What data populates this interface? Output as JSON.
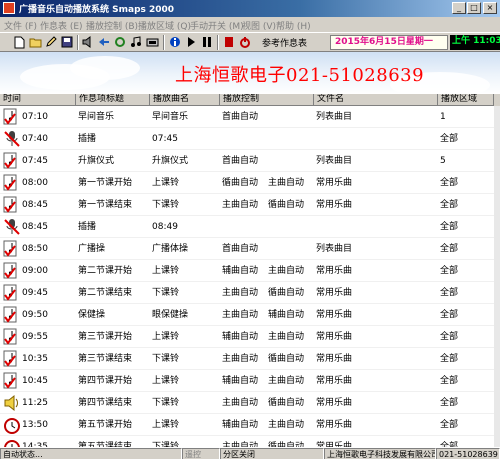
{
  "window": {
    "title": "广播音乐自动播放系统 Smaps 2000",
    "minimize": "_",
    "maximize": "□",
    "close": "×"
  },
  "menu": [
    "文件 (F)",
    "作息表 (E)",
    "播放控制 (B)",
    "播放区域 (Q)",
    "手动开关 (M)",
    "视图 (V)",
    "帮助 (H)"
  ],
  "toolbar": {
    "icons": [
      "new-file-icon",
      "open-folder-icon",
      "edit-icon",
      "save-icon",
      "speaker-icon",
      "back-icon",
      "refresh-icon",
      "music-icon",
      "panel-icon",
      "info-icon",
      "play-icon",
      "pause-icon",
      "bookmark-icon",
      "power-icon"
    ],
    "info_label": "参考作息表",
    "date": "2015年6月15日星期一",
    "clock": "上午 11:03"
  },
  "banner": {
    "company": "上海恒歌电子021-51028639"
  },
  "table": {
    "columns": [
      "时间",
      "作息项标题",
      "播放曲名",
      "播放控制",
      "文件名",
      "播放区域"
    ],
    "rows": [
      {
        "icon": "music-note-check",
        "time": "07:10",
        "title": "早间音乐",
        "song": "早间音乐",
        "ctrl1": "首曲自动",
        "ctrl2": "",
        "file": "列表曲目",
        "zone": "1"
      },
      {
        "icon": "microphone",
        "time": "07:40",
        "title": "插播",
        "song": "07:45",
        "ctrl1": "",
        "ctrl2": "",
        "file": "",
        "zone": "全部"
      },
      {
        "icon": "music-note-check",
        "time": "07:45",
        "title": "升旗仪式",
        "song": "升旗仪式",
        "ctrl1": "首曲自动",
        "ctrl2": "",
        "file": "列表曲目",
        "zone": "5"
      },
      {
        "icon": "music-note-check",
        "time": "08:00",
        "title": "第一节课开始",
        "song": "上课铃",
        "ctrl1": "循曲自动",
        "ctrl2": "主曲自动",
        "file": "常用乐曲",
        "zone": "全部"
      },
      {
        "icon": "music-note-check",
        "time": "08:45",
        "title": "第一节课结束",
        "song": "下课铃",
        "ctrl1": "主曲自动",
        "ctrl2": "循曲自动",
        "file": "常用乐曲",
        "zone": "全部"
      },
      {
        "icon": "microphone",
        "time": "08:45",
        "title": "插播",
        "song": "08:49",
        "ctrl1": "",
        "ctrl2": "",
        "file": "",
        "zone": "全部"
      },
      {
        "icon": "music-note-check",
        "time": "08:50",
        "title": "广播操",
        "song": "广播体操",
        "ctrl1": "首曲自动",
        "ctrl2": "",
        "file": "列表曲目",
        "zone": "全部"
      },
      {
        "icon": "music-note-check",
        "time": "09:00",
        "title": "第二节课开始",
        "song": "上课铃",
        "ctrl1": "辅曲自动",
        "ctrl2": "主曲自动",
        "file": "常用乐曲",
        "zone": "全部"
      },
      {
        "icon": "music-note-check",
        "time": "09:45",
        "title": "第二节课结束",
        "song": "下课铃",
        "ctrl1": "主曲自动",
        "ctrl2": "循曲自动",
        "file": "常用乐曲",
        "zone": "全部"
      },
      {
        "icon": "music-note-check",
        "time": "09:50",
        "title": "保健操",
        "song": "眼保健操",
        "ctrl1": "主曲自动",
        "ctrl2": "辅曲自动",
        "file": "常用乐曲",
        "zone": "全部"
      },
      {
        "icon": "music-note-check",
        "time": "09:55",
        "title": "第三节课开始",
        "song": "上课铃",
        "ctrl1": "辅曲自动",
        "ctrl2": "主曲自动",
        "file": "常用乐曲",
        "zone": "全部"
      },
      {
        "icon": "music-note-check",
        "time": "10:35",
        "title": "第三节课结束",
        "song": "下课铃",
        "ctrl1": "主曲自动",
        "ctrl2": "循曲自动",
        "file": "常用乐曲",
        "zone": "全部"
      },
      {
        "icon": "music-note-check",
        "time": "10:45",
        "title": "第四节课开始",
        "song": "上课铃",
        "ctrl1": "辅曲自动",
        "ctrl2": "主曲自动",
        "file": "常用乐曲",
        "zone": "全部"
      },
      {
        "icon": "speaker",
        "time": "11:25",
        "title": "第四节课结束",
        "song": "下课铃",
        "ctrl1": "主曲自动",
        "ctrl2": "循曲自动",
        "file": "常用乐曲",
        "zone": "全部"
      },
      {
        "icon": "alarm-clock",
        "time": "13:50",
        "title": "第五节课开始",
        "song": "上课铃",
        "ctrl1": "辅曲自动",
        "ctrl2": "主曲自动",
        "file": "常用乐曲",
        "zone": "全部"
      },
      {
        "icon": "alarm-clock",
        "time": "14:35",
        "title": "第五节课结束",
        "song": "下课铃",
        "ctrl1": "主曲自动",
        "ctrl2": "循曲自动",
        "file": "常用乐曲",
        "zone": "全部"
      }
    ]
  },
  "status": {
    "left": "自动状态...",
    "mode": "遥控",
    "zone": "分区关闭",
    "company": "上海恒歌电子科技发展有限公司",
    "phone": "021-51028639"
  },
  "colors": {
    "banner_text": "#ff0000",
    "date_text": "#e0108c",
    "clock_text": "#00ff40",
    "clock_bg": "#000000"
  }
}
